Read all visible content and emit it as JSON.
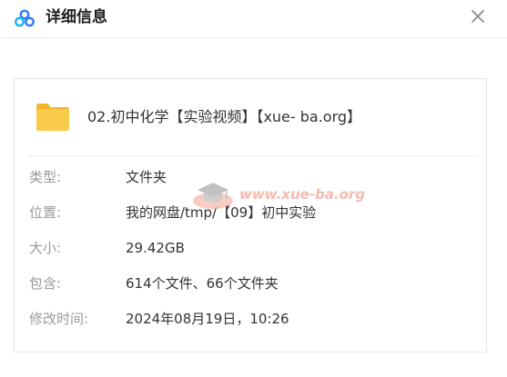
{
  "window": {
    "title": "详细信息",
    "logo_icon": "baidu-netdisk-logo",
    "close_icon": "close-icon"
  },
  "file": {
    "icon": "folder-icon",
    "name": "02.初中化学【实验视频】【xue- ba.org】"
  },
  "details": [
    {
      "label": "类型:",
      "value": "文件夹"
    },
    {
      "label": "位置:",
      "value": "我的网盘/tmp/【09】初中实验"
    },
    {
      "label": "大小:",
      "value": "29.42GB"
    },
    {
      "label": "包含:",
      "value": "614个文件、66个文件夹"
    },
    {
      "label": "修改时间:",
      "value": "2024年08月19日，10:26"
    }
  ],
  "watermark": {
    "text": "www.xue-ba.org"
  },
  "colors": {
    "folder": "#f7c23e",
    "logo_blue": "#2f7cf6",
    "logo_cyan": "#18b4e8",
    "watermark": "#f0836c"
  }
}
